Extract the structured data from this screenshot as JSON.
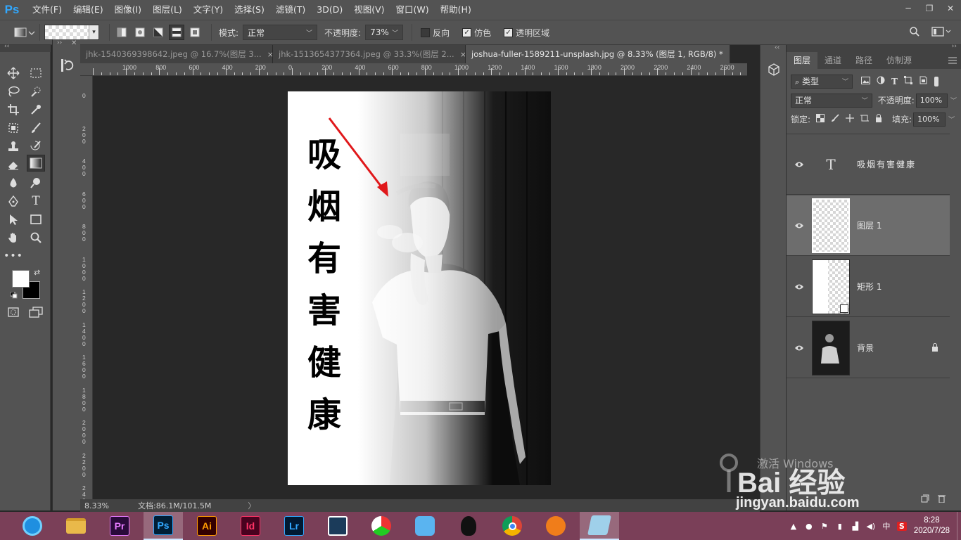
{
  "app": {
    "logo": "Ps"
  },
  "menu": [
    "文件(F)",
    "编辑(E)",
    "图像(I)",
    "图层(L)",
    "文字(Y)",
    "选择(S)",
    "滤镜(T)",
    "3D(D)",
    "视图(V)",
    "窗口(W)",
    "帮助(H)"
  ],
  "window_controls": [
    "─",
    "❐",
    "✕"
  ],
  "options": {
    "mode_label": "模式:",
    "mode_value": "正常",
    "opacity_label": "不透明度:",
    "opacity_value": "73%",
    "reverse_label": "反向",
    "reverse_checked": false,
    "dither_label": "仿色",
    "dither_checked": true,
    "transparency_label": "透明区域",
    "transparency_checked": true
  },
  "tabs": [
    {
      "title": "jhk-1540369398642.jpeg @ 16.7%(图层 3...",
      "close": "×"
    },
    {
      "title": "jhk-1513654377364.jpeg @ 33.3%(图层 2...",
      "close": "×"
    },
    {
      "title": "joshua-fuller-1589211-unsplash.jpg @ 8.33% (图层 1, RGB/8) *",
      "close": "×",
      "active": true
    }
  ],
  "ruler": {
    "h": [
      "1000",
      "800",
      "600",
      "400",
      "200",
      "0",
      "200",
      "400",
      "600",
      "800",
      "1000",
      "1200",
      "1400",
      "1600",
      "1800",
      "2000",
      "2200",
      "2400",
      "2600"
    ],
    "v": [
      "0",
      "2\n0\n0",
      "4\n0\n0",
      "6\n0\n0",
      "8\n0\n0",
      "1\n0\n0\n0",
      "1\n2\n0\n0",
      "1\n4\n0\n0",
      "1\n6\n0\n0",
      "1\n8\n0\n0",
      "2\n0\n0\n0",
      "2\n2\n0\n0",
      "2\n4\n0\n0"
    ]
  },
  "artwork": {
    "characters": [
      "吸",
      "烟",
      "有",
      "害",
      "健",
      "康"
    ]
  },
  "status": {
    "zoom": "8.33%",
    "doc": "文档:86.1M/101.5M",
    "arrow": "〉"
  },
  "layers_panel": {
    "tabs": [
      "图层",
      "通道",
      "路径",
      "仿制源"
    ],
    "filter_label": "类型",
    "blend_mode": "正常",
    "opacity_label": "不透明度:",
    "opacity_value": "100%",
    "lock_label": "锁定:",
    "fill_label": "填充:",
    "fill_value": "100%",
    "layers": [
      {
        "name": "吸烟有害健康",
        "type": "text",
        "selected": false
      },
      {
        "name": "图层 1",
        "type": "pixel",
        "selected": true
      },
      {
        "name": "矩形 1",
        "type": "shape",
        "selected": false
      },
      {
        "name": "背景",
        "type": "background",
        "selected": false,
        "locked": true
      }
    ]
  },
  "watermark": {
    "activate": "激活 Windows",
    "brand": "Bai 经验",
    "url": "jingyan.baidu.com"
  },
  "taskbar": {
    "apps": [
      {
        "name": "browser-360",
        "label": "",
        "color": "#1f8fe0"
      },
      {
        "name": "file-explorer",
        "label": "",
        "color": "#e9b94a"
      },
      {
        "name": "premiere",
        "label": "Pr",
        "color": "#2a0a3a",
        "fg": "#e77bff"
      },
      {
        "name": "photoshop",
        "label": "Ps",
        "color": "#001e36",
        "fg": "#31a8ff",
        "active": true
      },
      {
        "name": "illustrator",
        "label": "Ai",
        "color": "#330000",
        "fg": "#ff9a00"
      },
      {
        "name": "indesign",
        "label": "Id",
        "color": "#49021f",
        "fg": "#ff3366"
      },
      {
        "name": "lightroom",
        "label": "Lr",
        "color": "#001a33",
        "fg": "#31a8ff"
      },
      {
        "name": "video-editor",
        "label": "",
        "color": "#1b3b5a"
      },
      {
        "name": "colorful-app",
        "label": "",
        "color": "#ffffff"
      },
      {
        "name": "bird-app",
        "label": "",
        "color": "#5ab4f0"
      },
      {
        "name": "qq",
        "label": "",
        "color": "#000000"
      },
      {
        "name": "chrome",
        "label": "",
        "color": "#ffffff"
      },
      {
        "name": "bird-orange",
        "label": "",
        "color": "#f07d1a"
      },
      {
        "name": "notes",
        "label": "",
        "color": "#9fd0ea",
        "active": true
      }
    ],
    "time": "8:28",
    "date": "2020/7/28",
    "ime": "中"
  }
}
